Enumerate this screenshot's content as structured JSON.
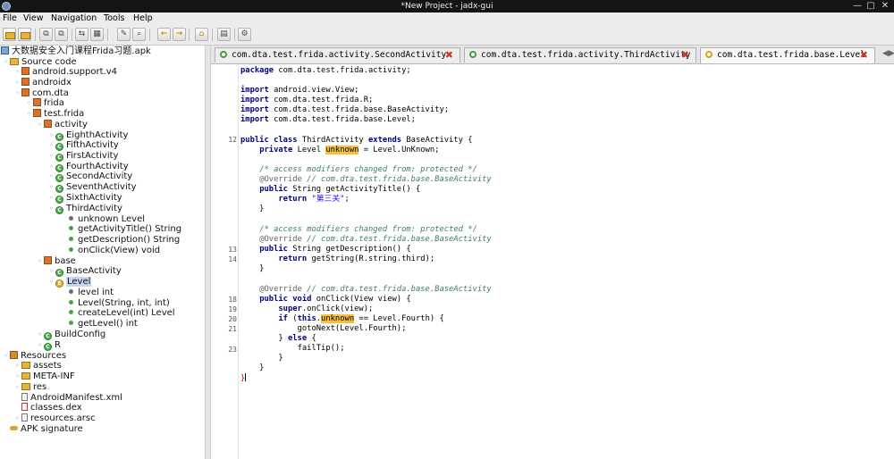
{
  "window": {
    "title": "*New Project - jadx-gui"
  },
  "menu": [
    "File",
    "View",
    "Navigation",
    "Tools",
    "Help"
  ],
  "toolbar": {
    "buttons": [
      "open-file",
      "add-files",
      "save-all",
      "export",
      "sync-with-editor",
      "flatten-packages",
      "search",
      "find-class",
      "decompile-all",
      "back",
      "forward",
      "preferences",
      "log",
      "deobfuscation"
    ]
  },
  "tree": {
    "root": "大数据安全入门课程Frida习题.apk",
    "source_code": "Source code",
    "pkg_android_support_v4": "android.support.v4",
    "pkg_androidx": "androidx",
    "pkg_com_dta": "com.dta",
    "pkg_frida": "frida",
    "pkg_test_frida": "test.frida",
    "pkg_activity": "activity",
    "activities": [
      "EighthActivity",
      "FifthActivity",
      "FirstActivity",
      "FourthActivity",
      "SecondActivity",
      "SeventhActivity",
      "SixthActivity",
      "ThirdActivity"
    ],
    "third_activity_members": [
      "unknown Level",
      "getActivityTitle() String",
      "getDescription() String",
      "onClick(View) void"
    ],
    "pkg_base": "base",
    "base_activity": "BaseActivity",
    "level": "Level",
    "level_members": [
      "level int",
      "Level(String, int, int)",
      "createLevel(int) Level",
      "getLevel() int"
    ],
    "build_config": "BuildConfig",
    "r_class": "R",
    "resources": "Resources",
    "resource_items": [
      "assets",
      "META-INF",
      "res",
      "AndroidManifest.xml",
      "classes.dex",
      "resources.arsc"
    ],
    "apk_signature": "APK signature"
  },
  "tabs": [
    {
      "label": "com.dta.test.frida.activity.SecondActivity",
      "kind": "class",
      "active": false
    },
    {
      "label": "com.dta.test.frida.activity.ThirdActivity",
      "kind": "class",
      "active": false
    },
    {
      "label": "com.dta.test.frida.base.Level",
      "kind": "enum",
      "active": true
    }
  ],
  "gutter": [
    "12",
    "13",
    "14",
    "18",
    "19",
    "20",
    "21",
    "23"
  ],
  "code": {
    "l1": "com.dta.test.frida.activity;",
    "imports": [
      "android.view.View;",
      "com.dta.test.frida.R;",
      "com.dta.test.frida.base.BaseActivity;",
      "com.dta.test.frida.base.Level;"
    ],
    "class_name": "ThirdActivity",
    "base_class": "BaseActivity {",
    "field_type": "Level",
    "field_name": "unknown",
    "field_init": " = Level.UnKnown;",
    "comment_protected": "/* access modifiers changed from: protected */",
    "override": "@Override",
    "override_comment": "// com.dta.test.frida.base.BaseActivity",
    "get_title_sig": "String getActivityTitle() {",
    "title_value": "\"第三关\"",
    "get_desc_sig": "String getDescription() {",
    "desc_return": "getString(R.string.third);",
    "onclick_sig": "onClick(View view) {",
    "super_call": ".onClick(view);",
    "if_cond": " == Level.Fourth) {",
    "goto_next": "gotoNext(Level.Fourth);",
    "fail_tip": "failTip();"
  }
}
